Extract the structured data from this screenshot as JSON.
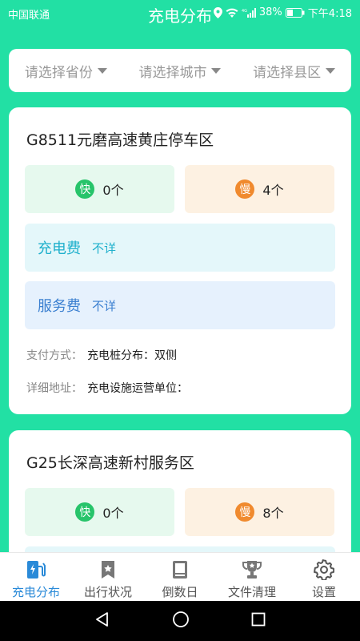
{
  "status_bar": {
    "carrier": "中国联通",
    "battery": "38%",
    "time": "下午4:18"
  },
  "app": {
    "title": "充电分布"
  },
  "filters": {
    "province": "请选择省份",
    "city": "请选择城市",
    "district": "请选择县区"
  },
  "labels": {
    "fast": "快",
    "slow": "慢",
    "charge_fee": "充电费",
    "service_fee": "服务费",
    "payment": "支付方式：",
    "address": "详细地址："
  },
  "stations": [
    {
      "name": "G8511元磨高速黄庄停车区",
      "fast_count": "0个",
      "slow_count": "4个",
      "charge_fee_value": "不详",
      "service_fee_value": "不详",
      "pile_distribution": "充电桩分布：双侧",
      "operator": "充电设施运营单位："
    },
    {
      "name": "G25长深高速新村服务区",
      "fast_count": "0个",
      "slow_count": "8个"
    }
  ],
  "bottom_nav": [
    {
      "label": "充电分布",
      "icon": "ev-charger-icon",
      "active": true
    },
    {
      "label": "出行状况",
      "icon": "bookmark-star-icon",
      "active": false
    },
    {
      "label": "倒数日",
      "icon": "calendar-book-icon",
      "active": false
    },
    {
      "label": "文件清理",
      "icon": "trophy-icon",
      "active": false
    },
    {
      "label": "设置",
      "icon": "gear-icon",
      "active": false
    }
  ],
  "colors": {
    "primary": "#22e0a4",
    "fast": "#27c46a",
    "slow": "#f08a2e",
    "active_nav": "#2a8ad8"
  }
}
